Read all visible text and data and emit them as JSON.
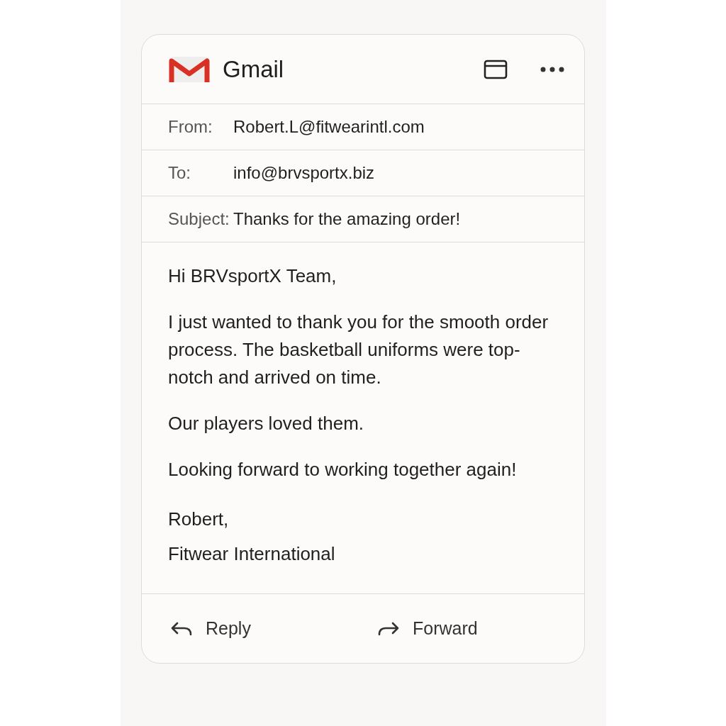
{
  "header": {
    "title": "Gmail"
  },
  "fields": [
    {
      "label": "From:",
      "value": "Robert.L@fitwearintl.com"
    },
    {
      "label": "To:",
      "value": "info@brvsportx.biz"
    },
    {
      "label": "Subject:",
      "value": "Thanks for the amazing order!"
    }
  ],
  "body": {
    "paragraphs": [
      "Hi BRVsportX Team,",
      "I just wanted to thank you for the smooth order process. The basketball uniforms were top-notch and arrived on time.",
      "Our players loved them.",
      "Looking forward to working together again!"
    ],
    "signature": [
      "Robert,",
      "Fitwear International"
    ]
  },
  "actions": [
    {
      "kind": "reply",
      "label": "Reply"
    },
    {
      "kind": "forward",
      "label": "Forward"
    }
  ]
}
